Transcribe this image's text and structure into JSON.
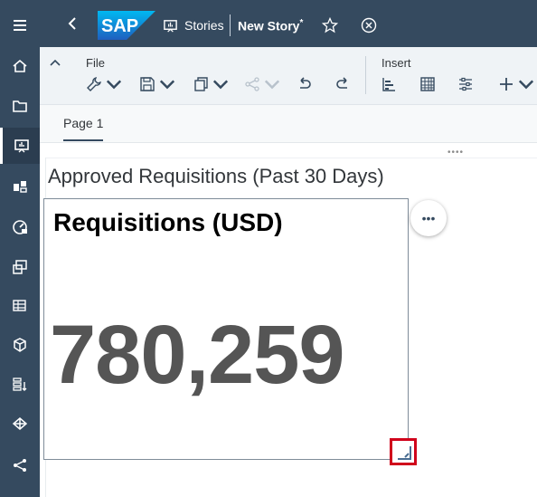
{
  "shell": {
    "logo_text": "SAP",
    "breadcrumb": "Stories",
    "story_name": "New Story",
    "unsaved_marker": "*"
  },
  "toolbar": {
    "file_label": "File",
    "insert_label": "Insert"
  },
  "tabs": [
    {
      "label": "Page 1"
    }
  ],
  "canvas": {
    "section_title": "Approved Requisitions (Past 30 Days)",
    "tile": {
      "title": "Requisitions (USD)",
      "value": "780,259"
    },
    "more_symbol": "•••",
    "grip_symbol": "••••"
  },
  "colors": {
    "shell_bg": "#354a5f",
    "highlight": "#d0021b",
    "sap_blue": "#1a8ff0"
  },
  "icons": {
    "rail": [
      "menu-icon",
      "home-icon",
      "folder-icon",
      "stories-icon",
      "analytic-app-icon",
      "digital-boardroom-icon",
      "presentation-icon",
      "data-grid-icon",
      "cube-icon",
      "data-integration-icon",
      "predictive-icon",
      "connections-icon"
    ]
  }
}
